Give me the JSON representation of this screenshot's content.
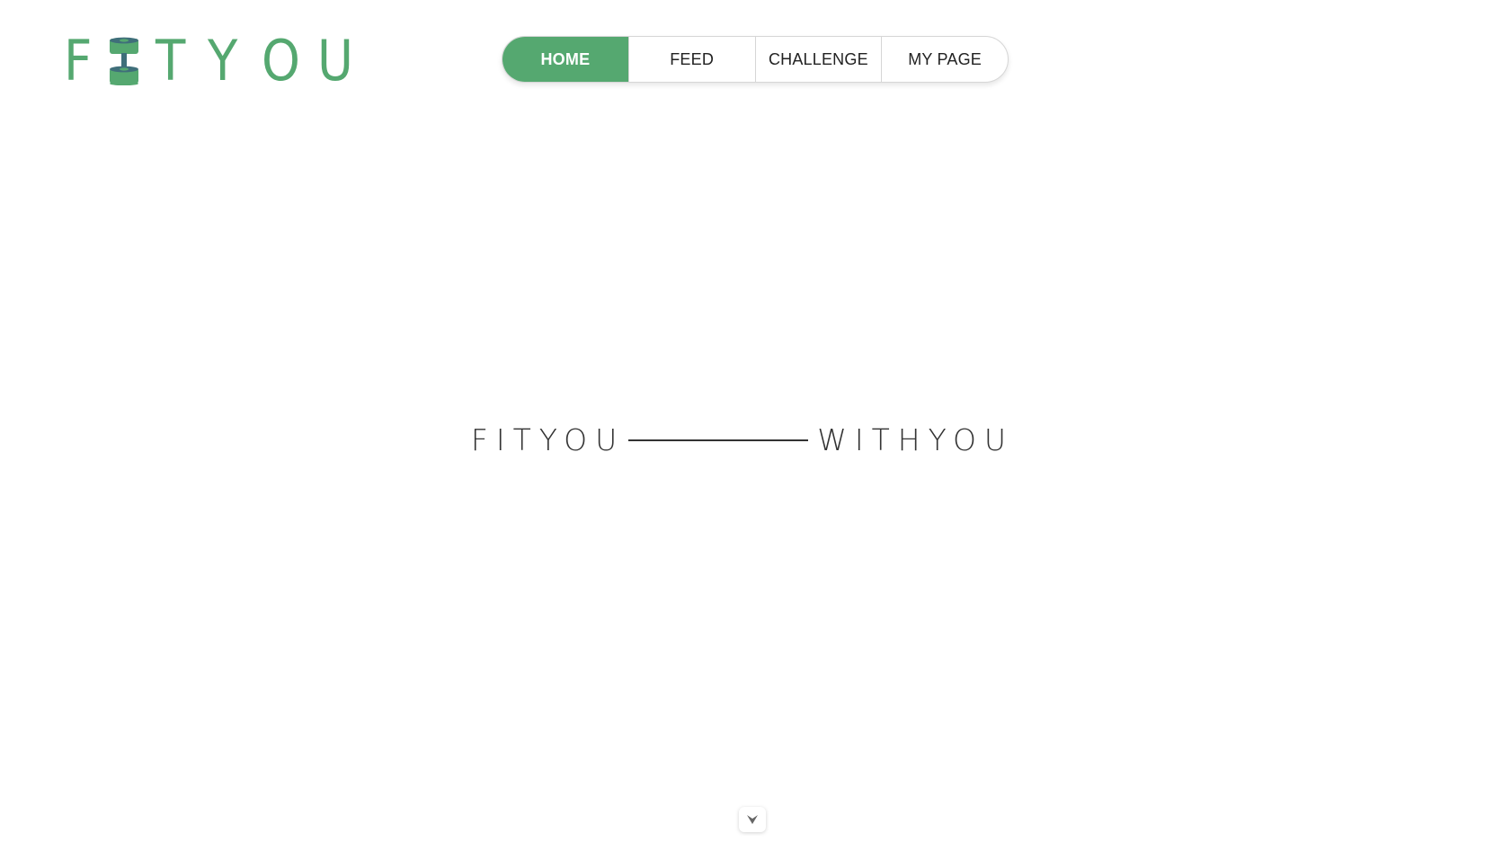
{
  "logo": {
    "letters_before": "F",
    "letters_after": [
      "T",
      "Y",
      "O",
      "U"
    ],
    "alt": "FITYOU",
    "color": "#55a870",
    "icon": "dumbbell-icon"
  },
  "nav": {
    "items": [
      {
        "label": "HOME",
        "active": true
      },
      {
        "label": "FEED",
        "active": false
      },
      {
        "label": "CHALLENGE",
        "active": false
      },
      {
        "label": "MY PAGE",
        "active": false
      }
    ],
    "accent": "#55a870"
  },
  "hero": {
    "left_word": "FITYOU",
    "right_word": "WITHYOU"
  },
  "scroll_button": {
    "icon": "chevron-down-icon"
  }
}
